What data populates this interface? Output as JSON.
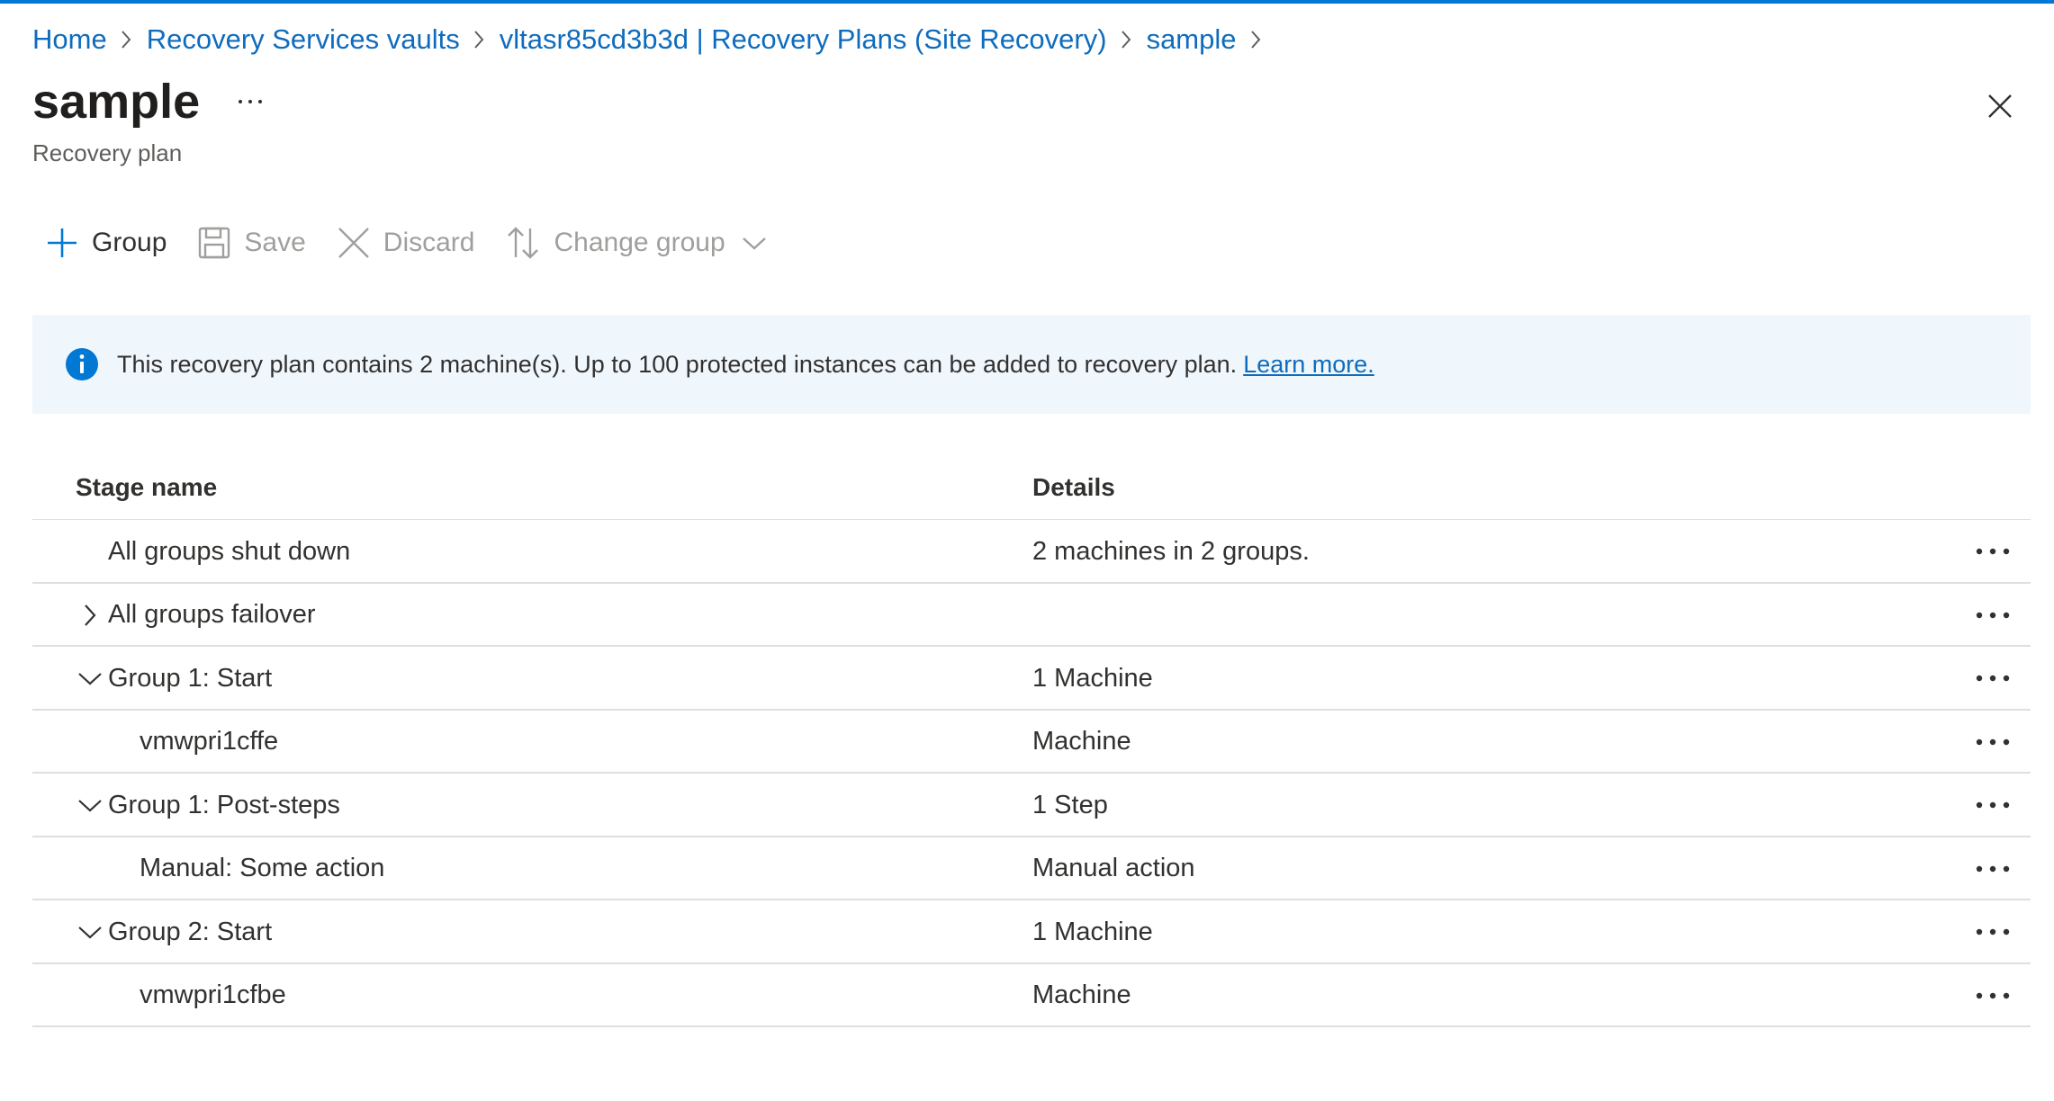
{
  "breadcrumb": {
    "items": [
      {
        "label": "Home"
      },
      {
        "label": "Recovery Services vaults"
      },
      {
        "label": "vltasr85cd3b3d | Recovery Plans (Site Recovery)"
      },
      {
        "label": "sample"
      }
    ]
  },
  "header": {
    "title": "sample",
    "subtitle": "Recovery plan"
  },
  "toolbar": {
    "group_label": "Group",
    "save_label": "Save",
    "discard_label": "Discard",
    "change_group_label": "Change group"
  },
  "info_bar": {
    "text": "This recovery plan contains 2 machine(s). Up to 100 protected instances can be added to recovery plan.",
    "link": "Learn more."
  },
  "table": {
    "columns": {
      "stage_name": "Stage name",
      "details": "Details"
    },
    "rows": [
      {
        "name": "All groups shut down",
        "details": "2 machines in 2 groups.",
        "level": 0,
        "expander": "none"
      },
      {
        "name": "All groups failover",
        "details": "",
        "level": 0,
        "expander": "collapsed"
      },
      {
        "name": "Group 1: Start",
        "details": "1 Machine",
        "level": 0,
        "expander": "expanded"
      },
      {
        "name": "vmwpri1cffe",
        "details": "Machine",
        "level": 1,
        "expander": "none"
      },
      {
        "name": "Group 1: Post-steps",
        "details": "1 Step",
        "level": 0,
        "expander": "expanded"
      },
      {
        "name": "Manual: Some action",
        "details": "Manual action",
        "level": 1,
        "expander": "none"
      },
      {
        "name": "Group 2: Start",
        "details": "1 Machine",
        "level": 0,
        "expander": "expanded"
      },
      {
        "name": "vmwpri1cfbe",
        "details": "Machine",
        "level": 1,
        "expander": "none"
      }
    ]
  },
  "colors": {
    "accent": "#0078d4",
    "link": "#0f6cbd",
    "info_background": "#eff6fc",
    "disabled_text": "#a19f9d",
    "divider": "#e1dfdd"
  },
  "icons": {
    "breadcrumb_separator": "chevron-right-icon",
    "title_more": "more-horizontal-icon",
    "close": "close-icon",
    "add_group": "plus-icon",
    "save": "save-icon",
    "discard": "dismiss-icon",
    "change_group": "arrow-sort-icon",
    "info": "info-icon",
    "row_more": "more-horizontal-icon",
    "expand": "chevron-right-icon",
    "collapse": "chevron-down-icon"
  }
}
